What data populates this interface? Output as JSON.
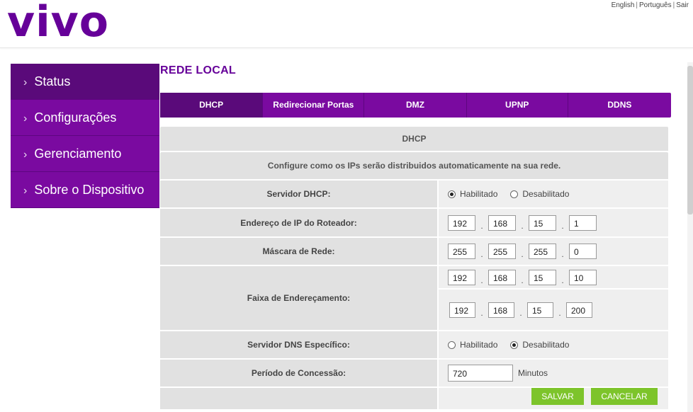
{
  "header": {
    "logo": "vivo",
    "lang": {
      "english": "English",
      "portugues": "Português",
      "sair": "Sair",
      "sep": "|"
    }
  },
  "sidebar": {
    "items": [
      {
        "label": "Status",
        "icon": "chevron-right-icon"
      },
      {
        "label": "Configurações",
        "icon": "chevron-right-icon"
      },
      {
        "label": "Gerenciamento",
        "icon": "chevron-right-icon"
      },
      {
        "label": "Sobre o Dispositivo",
        "icon": "chevron-right-icon"
      }
    ]
  },
  "page_title": "REDE LOCAL",
  "tabs": [
    "DHCP",
    "Redirecionar Portas",
    "DMZ",
    "UPNP",
    "DDNS"
  ],
  "form": {
    "section_title": "DHCP",
    "description": "Configure como os IPs serão distribuidos automaticamente na sua rede.",
    "dhcp_server": {
      "label": "Servidor DHCP:",
      "opt_enabled": "Habilitado",
      "opt_disabled": "Desabilitado",
      "selected": "Habilitado"
    },
    "router_ip": {
      "label": "Endereço de IP do Roteador:",
      "o1": "192",
      "o2": "168",
      "o3": "15",
      "o4": "1"
    },
    "netmask": {
      "label": "Máscara de Rede:",
      "o1": "255",
      "o2": "255",
      "o3": "255",
      "o4": "0"
    },
    "range": {
      "label": "Faixa de Endereçamento:",
      "start": {
        "o1": "192",
        "o2": "168",
        "o3": "15",
        "o4": "10"
      },
      "end": {
        "o1": "192",
        "o2": "168",
        "o3": "15",
        "o4": "200"
      }
    },
    "dns_server": {
      "label": "Servidor DNS Específico:",
      "opt_enabled": "Habilitado",
      "opt_disabled": "Desabilitado",
      "selected": "Desabilitado"
    },
    "lease": {
      "label": "Período de Concessão:",
      "value": "720",
      "unit": "Minutos"
    },
    "buttons": {
      "save": "SALVAR",
      "cancel": "CANCELAR"
    }
  },
  "colors": {
    "brand": "#660099",
    "menu": "#7a0aa0",
    "menu_active": "#5a0a7a",
    "accent_button": "#7dc42b"
  },
  "icons": [
    "chevron-right-icon",
    "radio-selected-icon",
    "radio-unselected-icon"
  ]
}
